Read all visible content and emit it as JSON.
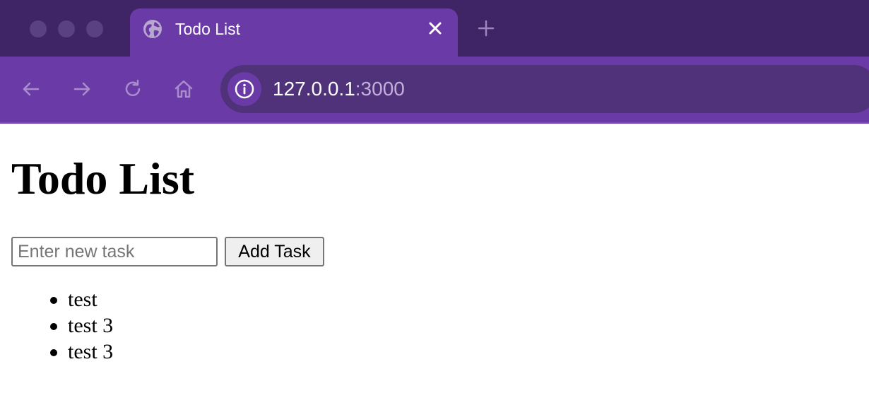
{
  "browser": {
    "tab": {
      "title": "Todo List",
      "icon": "globe-icon",
      "close_icon": "close-icon"
    },
    "new_tab_icon": "plus-icon",
    "nav": [
      "back-icon",
      "forward-icon",
      "reload-icon",
      "home-icon"
    ],
    "address": {
      "host": "127.0.0.1",
      "port": ":3000",
      "icon": "info-icon"
    },
    "colors": {
      "tabstrip": "#3f2566",
      "active": "#6a3ba6",
      "omnibox": "#4f327a"
    }
  },
  "page": {
    "heading": "Todo List",
    "input": {
      "placeholder": "Enter new task",
      "value": ""
    },
    "add_button": "Add Task",
    "tasks": [
      "test",
      "test 3",
      "test 3"
    ]
  }
}
